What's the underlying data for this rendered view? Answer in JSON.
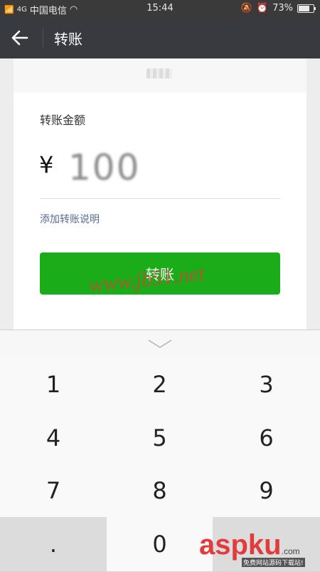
{
  "status_bar": {
    "signal_text": "4G",
    "carrier": "中国电信",
    "time": "15:44",
    "battery_percent": "73%",
    "battery_level": 0.73
  },
  "header": {
    "title": "转账"
  },
  "transfer": {
    "amount_label": "转账金额",
    "currency_symbol": "¥",
    "amount_value": "100",
    "add_note_label": "添加转账说明",
    "submit_label": "转账"
  },
  "keypad": {
    "keys": [
      "1",
      "2",
      "3",
      "4",
      "5",
      "6",
      "7",
      "8",
      "9",
      ".",
      "0",
      ""
    ]
  },
  "watermarks": {
    "site_one": "www.jb51.net",
    "site_two": "aspku",
    "site_two_suffix": ".com",
    "site_two_slogan": "免费网站源码下载站!"
  },
  "colors": {
    "status_bar": "#3a3a3a",
    "title_bar": "#393a3f",
    "primary_button": "#1aad19",
    "link": "#576b95"
  }
}
